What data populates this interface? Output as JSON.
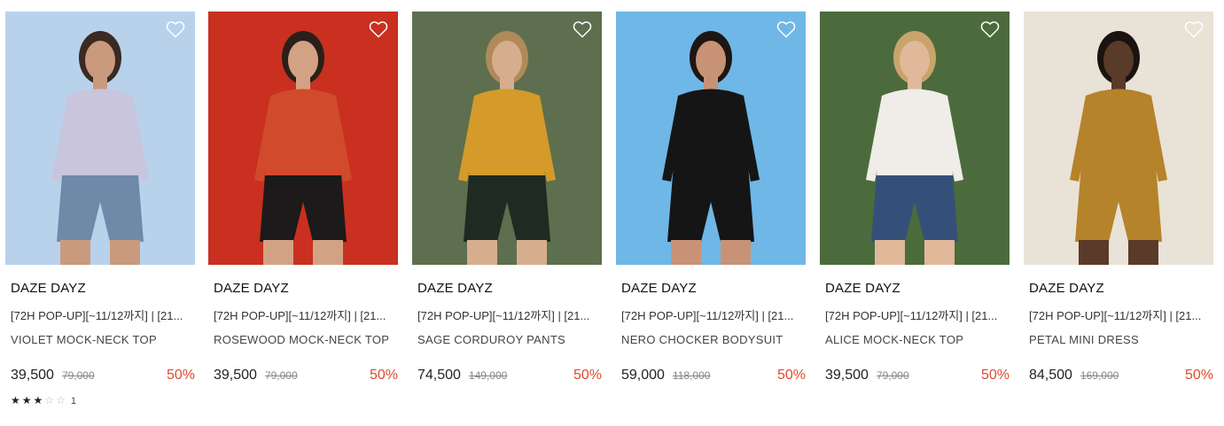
{
  "products": [
    {
      "brand": "DAZE DAYZ",
      "promo": "[72H POP-UP][~11/12까지] | [21...",
      "name": "VIOLET MOCK-NECK TOP",
      "price": "39,500",
      "original_price": "79,000",
      "discount": "50%",
      "rating": {
        "stars": 3,
        "max": 5,
        "count": "1"
      },
      "wishlist_icon": "heart-outline-icon",
      "photo_colors": {
        "bg": "#b8d2ec",
        "top": "#c9c5dc",
        "bottom": "#6e8aa8",
        "skin": "#c99a7e",
        "hair": "#3a2a22"
      }
    },
    {
      "brand": "DAZE DAYZ",
      "promo": "[72H POP-UP][~11/12까지] | [21...",
      "name": "ROSEWOOD MOCK-NECK TOP",
      "price": "39,500",
      "original_price": "79,000",
      "discount": "50%",
      "wishlist_icon": "heart-outline-icon",
      "photo_colors": {
        "bg": "#c9301f",
        "top": "#d24a2c",
        "bottom": "#1c1a1a",
        "skin": "#d3a284",
        "hair": "#2b1f1a"
      }
    },
    {
      "brand": "DAZE DAYZ",
      "promo": "[72H POP-UP][~11/12까지] | [21...",
      "name": "SAGE CORDUROY PANTS",
      "price": "74,500",
      "original_price": "149,000",
      "discount": "50%",
      "wishlist_icon": "heart-outline-icon",
      "photo_colors": {
        "bg": "#5d6f4e",
        "top": "#d49a2a",
        "bottom": "#1f2a22",
        "skin": "#d6ae8e",
        "hair": "#b08a5a"
      }
    },
    {
      "brand": "DAZE DAYZ",
      "promo": "[72H POP-UP][~11/12까지] | [21...",
      "name": "NERO CHOCKER BODYSUIT",
      "price": "59,000",
      "original_price": "118,000",
      "discount": "50%",
      "wishlist_icon": "heart-outline-icon",
      "photo_colors": {
        "bg": "#6fb7e6",
        "top": "#151515",
        "bottom": "#151515",
        "skin": "#c89276",
        "hair": "#1e1612"
      }
    },
    {
      "brand": "DAZE DAYZ",
      "promo": "[72H POP-UP][~11/12까지] | [21...",
      "name": "ALICE MOCK-NECK TOP",
      "price": "39,500",
      "original_price": "79,000",
      "discount": "50%",
      "wishlist_icon": "heart-outline-icon",
      "photo_colors": {
        "bg": "#4c6b3c",
        "top": "#f0ece8",
        "bottom": "#34507a",
        "skin": "#e0b89a",
        "hair": "#c9a46a"
      }
    },
    {
      "brand": "DAZE DAYZ",
      "promo": "[72H POP-UP][~11/12까지] | [21...",
      "name": "PETAL MINI DRESS",
      "price": "84,500",
      "original_price": "169,000",
      "discount": "50%",
      "wishlist_icon": "heart-outline-icon",
      "photo_colors": {
        "bg": "#e9e2d6",
        "top": "#b5832a",
        "bottom": "#b5832a",
        "skin": "#5a3a28",
        "hair": "#1a1310"
      }
    }
  ]
}
